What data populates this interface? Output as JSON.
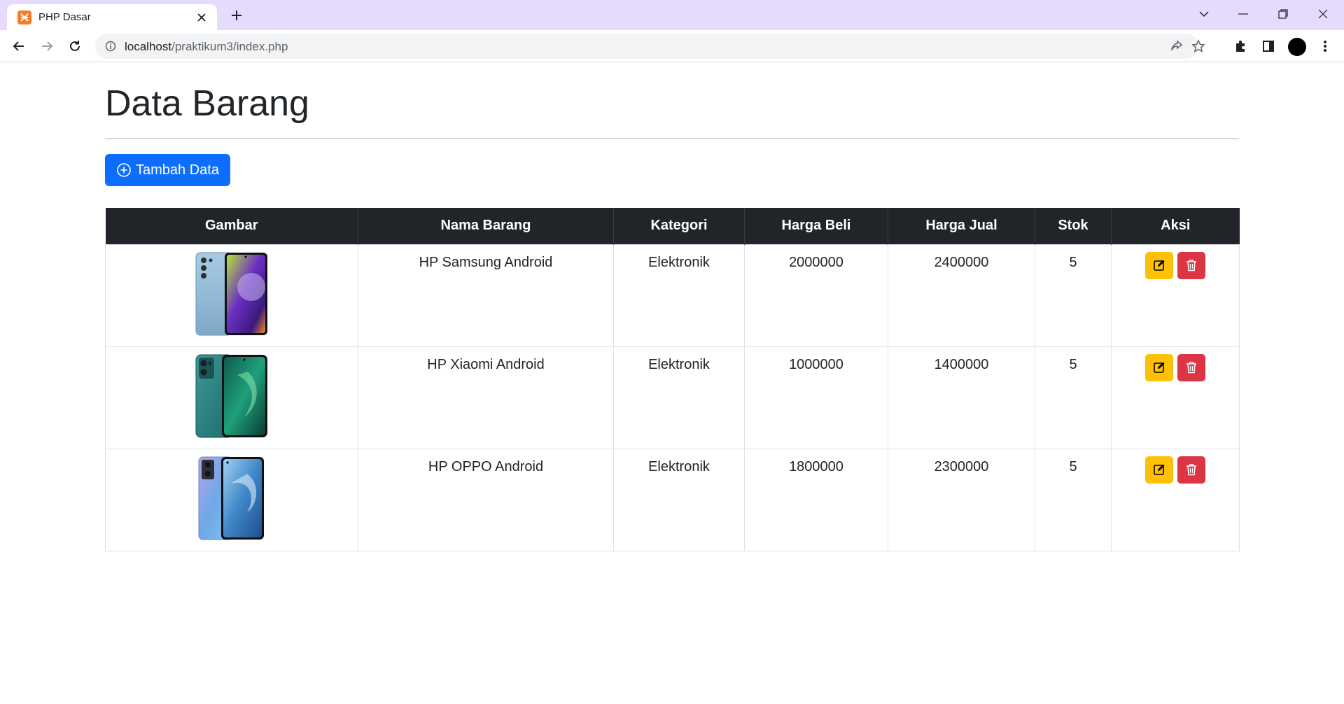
{
  "browser": {
    "tab_title": "PHP Dasar",
    "url_host": "localhost",
    "url_path": "/praktikum3/index.php"
  },
  "page": {
    "title": "Data Barang",
    "add_button_label": "Tambah Data"
  },
  "table": {
    "headers": [
      "Gambar",
      "Nama Barang",
      "Kategori",
      "Harga Beli",
      "Harga Jual",
      "Stok",
      "Aksi"
    ],
    "rows": [
      {
        "nama": "HP Samsung Android",
        "kategori": "Elektronik",
        "harga_beli": "2000000",
        "harga_jual": "2400000",
        "stok": "5",
        "image": "samsung-phone"
      },
      {
        "nama": "HP Xiaomi Android",
        "kategori": "Elektronik",
        "harga_beli": "1000000",
        "harga_jual": "1400000",
        "stok": "5",
        "image": "xiaomi-phone"
      },
      {
        "nama": "HP OPPO Android",
        "kategori": "Elektronik",
        "harga_beli": "1800000",
        "harga_jual": "2300000",
        "stok": "5",
        "image": "oppo-phone"
      }
    ]
  },
  "colors": {
    "primary": "#0d6efd",
    "warning": "#ffc107",
    "danger": "#dc3545",
    "table_header": "#212529",
    "tabbar": "#e6dafd"
  },
  "icons": [
    "xampp-icon",
    "close-icon",
    "plus-icon",
    "chevron-down-icon",
    "minimize-icon",
    "restore-icon",
    "back-icon",
    "forward-icon",
    "reload-icon",
    "info-icon",
    "share-icon",
    "star-icon",
    "puzzle-icon",
    "sidepanel-icon",
    "menu-icon",
    "plus-circle-icon",
    "edit-icon",
    "trash-icon"
  ]
}
